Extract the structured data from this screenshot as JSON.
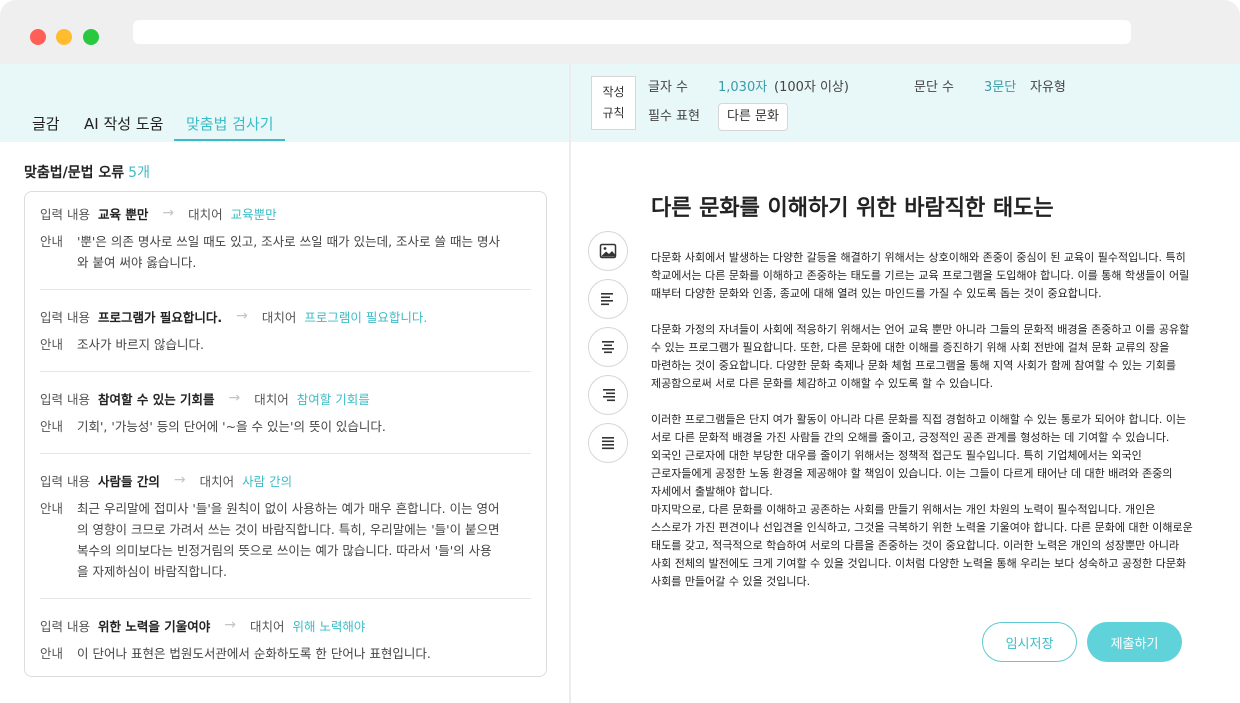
{
  "tabs": [
    {
      "label": "글감"
    },
    {
      "label": "AI 작성 도움"
    },
    {
      "label": "맞춤법 검사기"
    }
  ],
  "errors": {
    "title": "맞춤법/문법 오류",
    "count": "5개",
    "input_label": "입력 내용",
    "suggest_label": "대치어",
    "guide_label": "안내",
    "items": [
      {
        "original": "교육 뿐만",
        "suggestion": "교육뿐만",
        "guide": "'뿐'은 의존 명사로 쓰일 때도 있고, 조사로 쓰일 때가 있는데, 조사로 쓸 때는 명사와 붙여 써야 옳습니다."
      },
      {
        "original": "프로그램가 필요합니다.",
        "suggestion": "프로그램이 필요합니다.",
        "guide": "조사가 바르지 않습니다."
      },
      {
        "original": "참여할 수 있는 기회를",
        "suggestion": "참여할 기회를",
        "guide": "기회', '가능성' 등의 단어에 '~을 수 있는'의 뜻이 있습니다."
      },
      {
        "original": "사람들 간의",
        "suggestion": "사람 간의",
        "guide": "최근 우리말에 접미사 '들'을 원칙이 없이 사용하는 예가 매우 흔합니다. 이는 영어의 영향이 크므로 가려서 쓰는 것이 바람직합니다. 특히, 우리말에는 '들'이 붙으면 복수의 의미보다는 빈정거림의 뜻으로 쓰이는 예가 많습니다. 따라서 '들'의 사용을 자제하심이 바람직합니다."
      },
      {
        "original": "위한 노력을 기울여야",
        "suggestion": "위해 노력해야",
        "guide": "이 단어나 표현은 법원도서관에서 순화하도록 한 단어나 표현입니다."
      }
    ]
  },
  "rules": {
    "box_line1": "작성",
    "box_line2": "규칙",
    "char_label": "글자 수",
    "char_value": "1,030자",
    "char_sub": "(100자 이상)",
    "para_label": "문단 수",
    "para_value": "3문단",
    "para_sub": "자유형",
    "required_label": "필수 표현",
    "required_value": "다른 문화"
  },
  "document": {
    "title": "다른 문화를 이해하기 위한 바람직한 태도는",
    "p1": "다문화 사회에서 발생하는 다양한 갈등을 해결하기 위해서는 상호이해와 존중이 중심이 된 교육이 필수적입니다. 특히 학교에서는 다른 문화를 이해하고 존중하는 태도를 기르는 교육 프로그램을 도입해야 합니다. 이를 통해 학생들이 어릴 때부터 다양한 문화와 인종, 종교에 대해 열려 있는 마인드를 가질 수 있도록 돕는 것이 중요합니다.",
    "p2": " 다문화 가정의 자녀들이 사회에 적응하기 위해서는 언어 교육 뿐만 아니라 그들의 문화적 배경을 존중하고 이를 공유할 수 있는 프로그램가 필요합니다. 또한, 다른 문화에 대한 이해를 증진하기 위해 사회 전반에 걸쳐 문화 교류의 장을 마련하는 것이 중요합니다. 다양한 문화 축제나 문화 체험 프로그램을 통해 지역 사회가 함께 참여할 수 있는 기회를 제공함으로써 서로 다른 문화를 체감하고 이해할 수 있도록 할 수 있습니다.",
    "p3": " 이러한 프로그램들은 단지 여가 활동이 아니라 다른 문화를 직접 경험하고 이해할 수 있는 통로가 되어야 합니다. 이는 서로 다른 문화적 배경을 가진 사람들 간의 오해를 줄이고, 긍정적인 공존 관계를 형성하는 데 기여할 수 있습니다. 외국인 근로자에 대한 부당한 대우를 줄이기 위해서는 정책적 접근도 필수입니다. 특히 기업체에서는 외국인 근로자들에게 공정한 노동 환경을 제공해야 할 책임이 있습니다. 이는 그들이 다르게 태어난 데 대한 배려와 존중의 자세에서 출발해야 합니다.",
    "p4": "마지막으로, 다른 문화를 이해하고 공존하는 사회를 만들기 위해서는 개인 차원의 노력이 필수적입니다. 개인은 스스로가 가진 편견이나 선입견을 인식하고, 그것을 극복하기 위한 노력을 기울여야 합니다. 다른 문화에 대한 이해로운 태도를 갖고, 적극적으로 학습하여 서로의 다름을 존중하는 것이 중요합니다. 이러한 노력은 개인의 성장뿐만 아니라 사회 전체의 발전에도 크게 기여할 수 있을 것입니다. 이처럼 다양한 노력을 통해 우리는 보다 성숙하고 공정한 다문화 사회를 만들어갈 수 있을 것입니다."
  },
  "buttons": {
    "save": "임시저장",
    "submit": "제출하기"
  },
  "colors": {
    "accent": "#3cbcc6",
    "header_bg": "#e8f7f8",
    "submit_bg": "#5fd2da"
  }
}
